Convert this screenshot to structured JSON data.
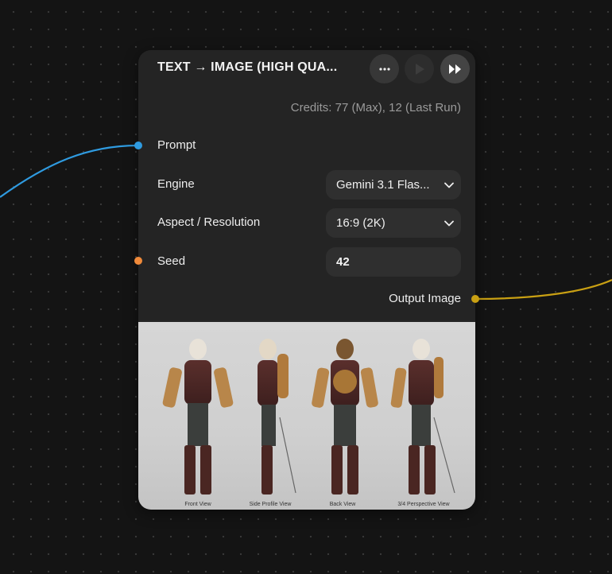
{
  "canvas": {
    "background": "#141414",
    "wire_prompt_color": "#2f9be0",
    "wire_seed_color": "#f08a3a",
    "wire_output_color": "#c9a013"
  },
  "node": {
    "title": "TEXT → IMAGE (HIGH QUA...",
    "header_buttons": {
      "more_icon": "more-horizontal-icon",
      "run_icon": "play-icon",
      "run_all_icon": "fast-forward-icon"
    },
    "credits": "Credits: 77 (Max), 12 (Last Run)",
    "inputs": {
      "prompt_label": "Prompt",
      "engine_label": "Engine",
      "engine_value": "Gemini 3.1 Flas...",
      "aspect_label": "Aspect / Resolution",
      "aspect_value": "16:9 (2K)",
      "seed_label": "Seed",
      "seed_value": "42"
    },
    "output": {
      "label": "Output Image",
      "views": [
        "Front View",
        "Side Profile View",
        "Back View",
        "3/4 Perspective View"
      ]
    }
  }
}
